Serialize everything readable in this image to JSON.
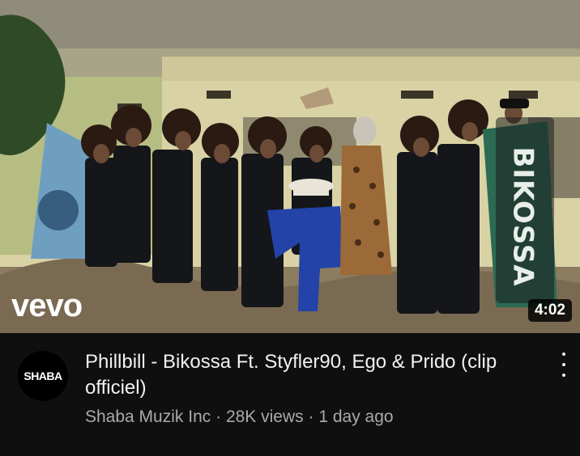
{
  "video": {
    "brand_mark": "vevo",
    "duration": "4:02",
    "banner_text": "BIKOSSA"
  },
  "channel": {
    "avatar_text": "SHABA"
  },
  "info": {
    "title": "Phillbill - Bikossa Ft. Styfler90, Ego & Prido (clip officiel)",
    "channel_name": "Shaba Muzik Inc",
    "separator": "·",
    "views": "28K views",
    "age": "1 day ago"
  },
  "icons": {
    "more": "more-vert-icon"
  }
}
